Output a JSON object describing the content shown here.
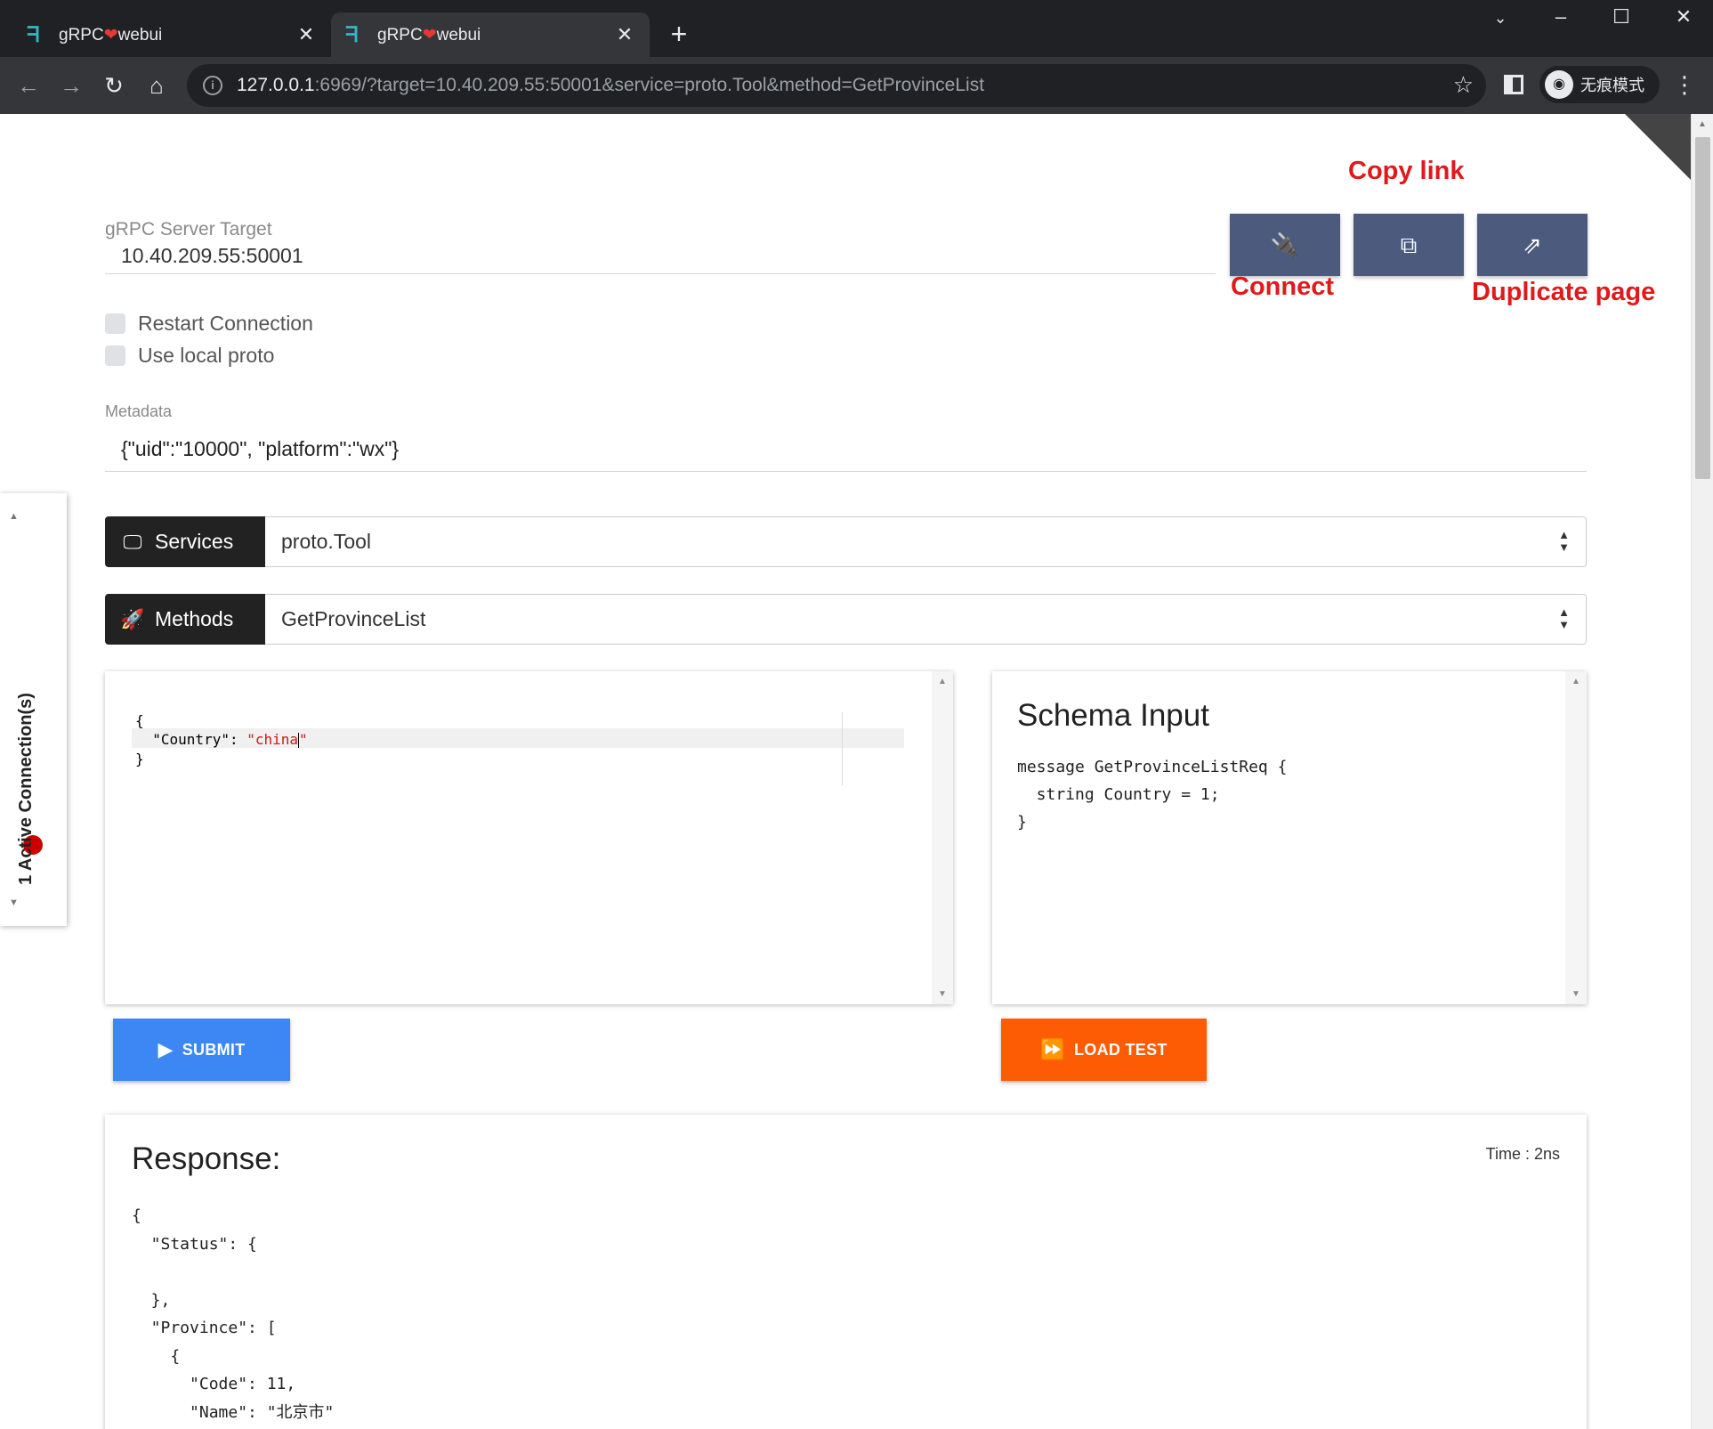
{
  "browser": {
    "tabs": [
      {
        "app": "gRPC",
        "heart": "❤",
        "name": "webui"
      },
      {
        "app": "gRPC",
        "heart": "❤",
        "name": "webui"
      }
    ],
    "url_host": "127.0.0.1",
    "url_rest": ":6969/?target=10.40.209.55:50001&service=proto.Tool&method=GetProvinceList",
    "incognito_label": "无痕模式"
  },
  "server": {
    "target_label": "gRPC Server Target",
    "target_value": "10.40.209.55:50001"
  },
  "annotations": {
    "copy_link": "Copy link",
    "connect": "Connect",
    "duplicate_page": "Duplicate page"
  },
  "options": {
    "restart_connection": "Restart Connection",
    "use_local_proto": "Use local proto"
  },
  "metadata": {
    "label": "Metadata",
    "value": "{\"uid\":\"10000\", \"platform\":\"wx\"}"
  },
  "services": {
    "label": "Services",
    "selected": "proto.Tool"
  },
  "methods": {
    "label": "Methods",
    "selected": "GetProvinceList"
  },
  "request_editor": {
    "line1": "{",
    "key": "\"Country\"",
    "sep": ": ",
    "value": "\"china",
    "close_quote": "\"",
    "line3": "}"
  },
  "schema": {
    "title": "Schema Input",
    "code": "message GetProvinceListReq {\n  string Country = 1;\n}"
  },
  "buttons": {
    "submit": "SUBMIT",
    "load_test": "LOAD TEST"
  },
  "response": {
    "title": "Response:",
    "time": "Time : 2ns",
    "body": "{\n  \"Status\": {\n\n  },\n  \"Province\": [\n    {\n      \"Code\": 11,\n      \"Name\": \"北京市\""
  },
  "connections": {
    "label": "1 Active Connection(s)"
  },
  "colors": {
    "connect_btn": "#4c5b7d",
    "submit": "#3d87f5",
    "load_test": "#fe5b05",
    "annotation": "#e0191b"
  }
}
